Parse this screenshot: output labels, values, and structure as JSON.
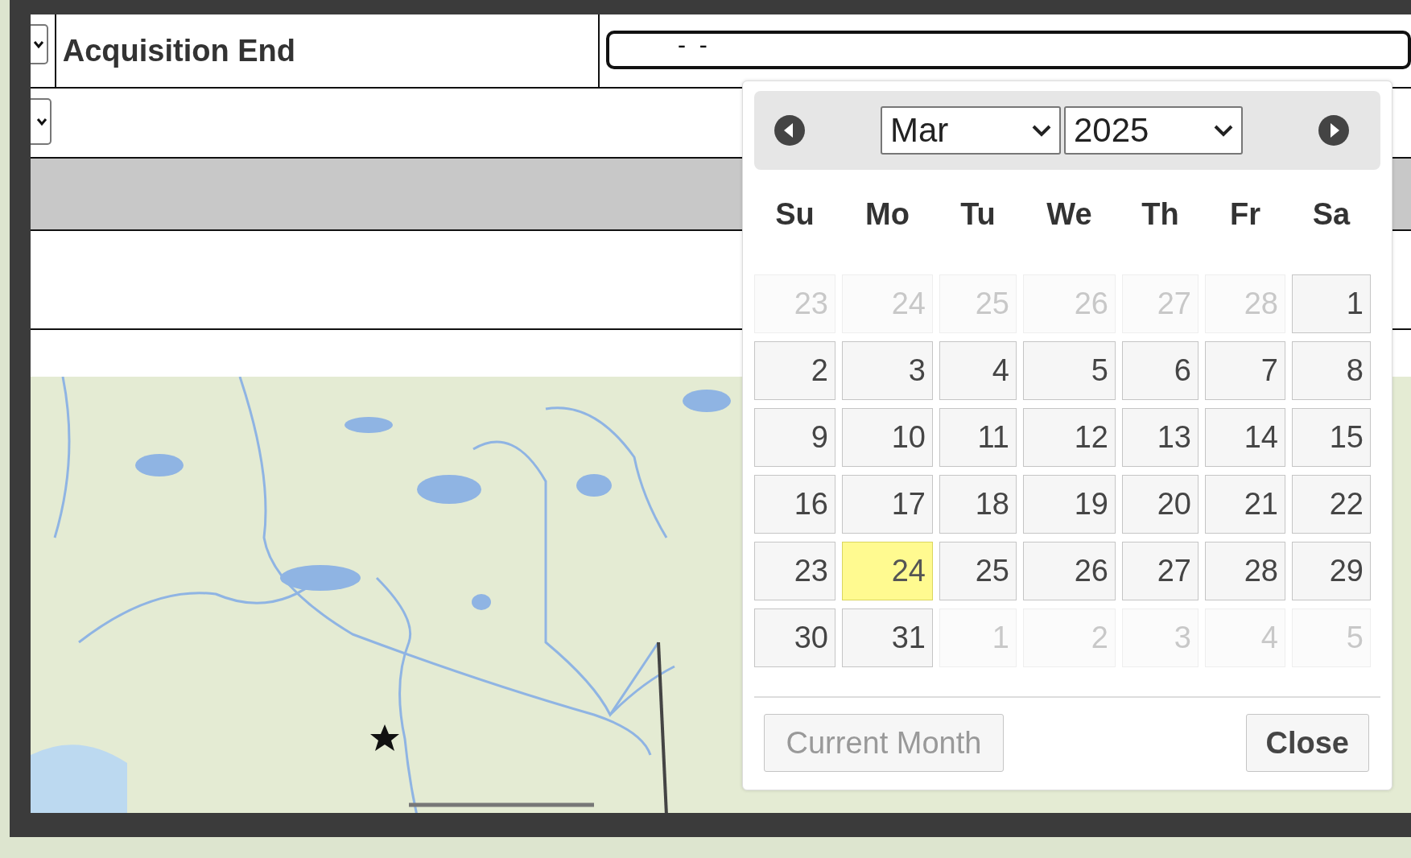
{
  "form": {
    "rows": [
      {
        "label": "Acquisition End",
        "value": "-  -",
        "shaded": false,
        "has_dropdown": true
      },
      {
        "label": "",
        "value": "",
        "shaded": false,
        "has_dropdown": true
      },
      {
        "label": "",
        "value": "",
        "shaded": true,
        "has_dropdown": false
      },
      {
        "label": "",
        "value": "",
        "shaded": false,
        "has_dropdown": false
      }
    ]
  },
  "datepicker": {
    "month": "Mar",
    "year": "2025",
    "weekdays": [
      "Su",
      "Mo",
      "Tu",
      "We",
      "Th",
      "Fr",
      "Sa"
    ],
    "days": [
      {
        "label": "23",
        "other_month": true,
        "today": false
      },
      {
        "label": "24",
        "other_month": true,
        "today": false
      },
      {
        "label": "25",
        "other_month": true,
        "today": false
      },
      {
        "label": "26",
        "other_month": true,
        "today": false
      },
      {
        "label": "27",
        "other_month": true,
        "today": false
      },
      {
        "label": "28",
        "other_month": true,
        "today": false
      },
      {
        "label": "1",
        "other_month": false,
        "today": false
      },
      {
        "label": "2",
        "other_month": false,
        "today": false
      },
      {
        "label": "3",
        "other_month": false,
        "today": false
      },
      {
        "label": "4",
        "other_month": false,
        "today": false
      },
      {
        "label": "5",
        "other_month": false,
        "today": false
      },
      {
        "label": "6",
        "other_month": false,
        "today": false
      },
      {
        "label": "7",
        "other_month": false,
        "today": false
      },
      {
        "label": "8",
        "other_month": false,
        "today": false
      },
      {
        "label": "9",
        "other_month": false,
        "today": false
      },
      {
        "label": "10",
        "other_month": false,
        "today": false
      },
      {
        "label": "11",
        "other_month": false,
        "today": false
      },
      {
        "label": "12",
        "other_month": false,
        "today": false
      },
      {
        "label": "13",
        "other_month": false,
        "today": false
      },
      {
        "label": "14",
        "other_month": false,
        "today": false
      },
      {
        "label": "15",
        "other_month": false,
        "today": false
      },
      {
        "label": "16",
        "other_month": false,
        "today": false
      },
      {
        "label": "17",
        "other_month": false,
        "today": false
      },
      {
        "label": "18",
        "other_month": false,
        "today": false
      },
      {
        "label": "19",
        "other_month": false,
        "today": false
      },
      {
        "label": "20",
        "other_month": false,
        "today": false
      },
      {
        "label": "21",
        "other_month": false,
        "today": false
      },
      {
        "label": "22",
        "other_month": false,
        "today": false
      },
      {
        "label": "23",
        "other_month": false,
        "today": false
      },
      {
        "label": "24",
        "other_month": false,
        "today": true
      },
      {
        "label": "25",
        "other_month": false,
        "today": false
      },
      {
        "label": "26",
        "other_month": false,
        "today": false
      },
      {
        "label": "27",
        "other_month": false,
        "today": false
      },
      {
        "label": "28",
        "other_month": false,
        "today": false
      },
      {
        "label": "29",
        "other_month": false,
        "today": false
      },
      {
        "label": "30",
        "other_month": false,
        "today": false
      },
      {
        "label": "31",
        "other_month": false,
        "today": false
      },
      {
        "label": "1",
        "other_month": true,
        "today": false
      },
      {
        "label": "2",
        "other_month": true,
        "today": false
      },
      {
        "label": "3",
        "other_month": true,
        "today": false
      },
      {
        "label": "4",
        "other_month": true,
        "today": false
      },
      {
        "label": "5",
        "other_month": true,
        "today": false
      }
    ],
    "buttons": [
      {
        "label": "Current Month",
        "disabled": true
      },
      {
        "label": "Close",
        "disabled": false
      }
    ]
  }
}
